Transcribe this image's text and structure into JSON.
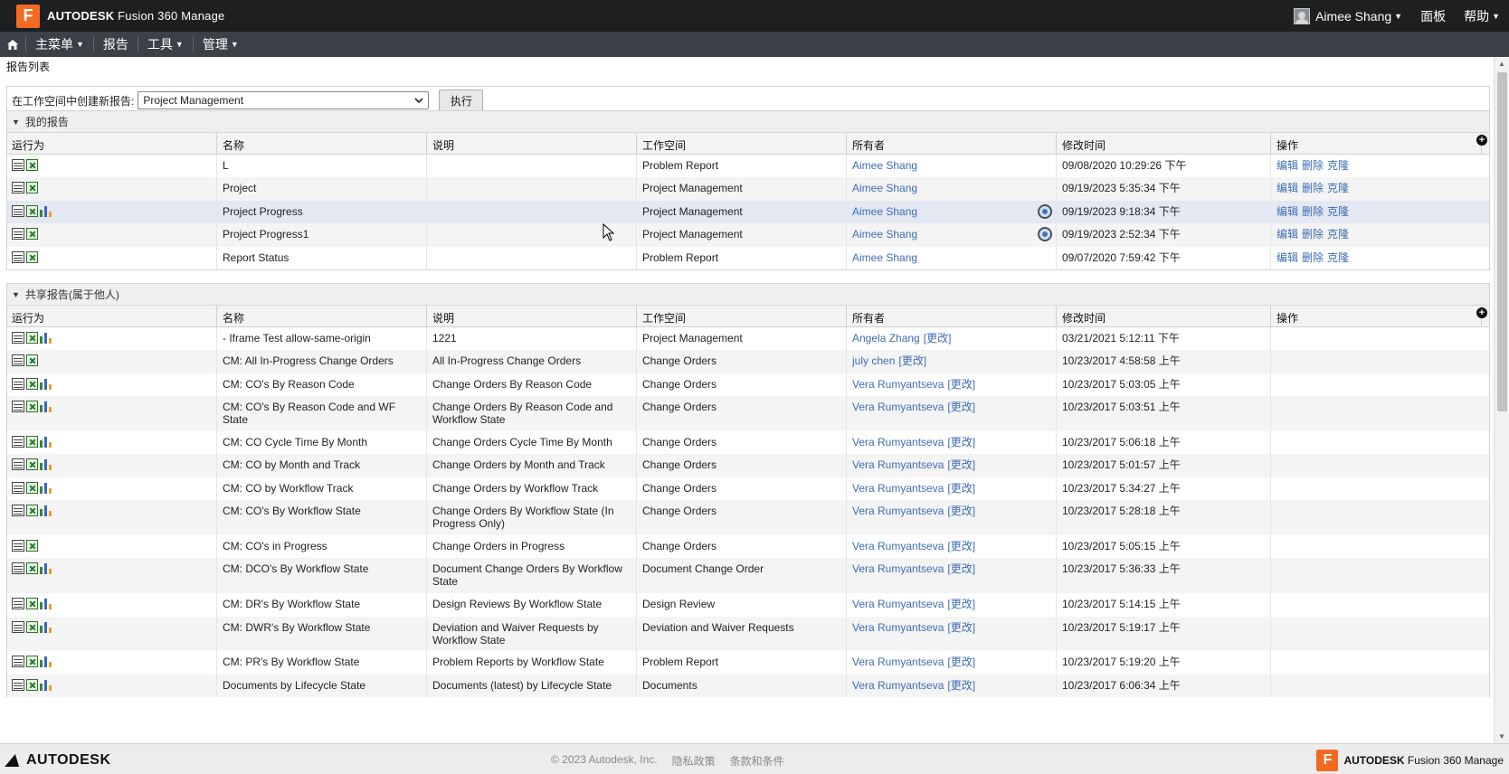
{
  "app": {
    "brand_bold": "AUTODESK",
    "brand_rest": "Fusion 360 Manage",
    "logo_letter": "F"
  },
  "topbar": {
    "user_name": "Aimee Shang",
    "dashboard": "面板",
    "help": "帮助"
  },
  "nav": {
    "main_menu": "主菜单",
    "reports": "报告",
    "tools": "工具",
    "admin": "管理"
  },
  "page": {
    "title": "报告列表"
  },
  "create": {
    "label": "在工作空间中创建新报告:",
    "selected_workspace": "Project Management",
    "execute": "执行"
  },
  "columns": [
    "运行为",
    "名称",
    "说明",
    "工作空间",
    "所有者",
    "修改时间",
    "操作"
  ],
  "my_reports": {
    "title": "我的报告",
    "actions": {
      "edit": "编辑",
      "delete": "删除",
      "clone": "克隆"
    },
    "rows": [
      {
        "icons": [
          "table",
          "xls"
        ],
        "name": "L",
        "desc": "",
        "workspace": "Problem Report",
        "owner": "Aimee Shang",
        "sync": false,
        "modified": "09/08/2020 10:29:26 下午"
      },
      {
        "icons": [
          "table",
          "xls"
        ],
        "name": "Project",
        "desc": "",
        "workspace": "Project Management",
        "owner": "Aimee Shang",
        "sync": false,
        "modified": "09/19/2023 5:35:34 下午"
      },
      {
        "icons": [
          "table",
          "xls",
          "chart"
        ],
        "name": "Project Progress",
        "desc": "",
        "workspace": "Project Management",
        "owner": "Aimee Shang",
        "sync": true,
        "modified": "09/19/2023 9:18:34 下午"
      },
      {
        "icons": [
          "table",
          "xls"
        ],
        "name": "Project Progress1",
        "desc": "",
        "workspace": "Project Management",
        "owner": "Aimee Shang",
        "sync": true,
        "modified": "09/19/2023 2:52:34 下午"
      },
      {
        "icons": [
          "table",
          "xls"
        ],
        "name": "Report Status",
        "desc": "",
        "workspace": "Problem Report",
        "owner": "Aimee Shang",
        "sync": false,
        "modified": "09/07/2020 7:59:42 下午"
      }
    ]
  },
  "shared_reports": {
    "title": "共享报告(属于他人)",
    "change_label": "[更改]",
    "rows": [
      {
        "icons": [
          "table",
          "xls",
          "chart"
        ],
        "name": "- Iframe Test allow-same-origin",
        "desc": "1221",
        "workspace": "Project Management",
        "owner": "Angela Zhang",
        "modified": "03/21/2021 5:12:11 下午"
      },
      {
        "icons": [
          "table",
          "xls"
        ],
        "name": "CM: All In-Progress Change Orders",
        "desc": "All In-Progress Change Orders",
        "workspace": "Change Orders",
        "owner": "july chen",
        "modified": "10/23/2017 4:58:58 上午"
      },
      {
        "icons": [
          "table",
          "xls",
          "chart"
        ],
        "name": "CM: CO's By Reason Code",
        "desc": "Change Orders By Reason Code",
        "workspace": "Change Orders",
        "owner": "Vera Rumyantseva",
        "modified": "10/23/2017 5:03:05 上午"
      },
      {
        "icons": [
          "table",
          "xls",
          "chart"
        ],
        "name": "CM: CO's By Reason Code and WF State",
        "desc": "Change Orders By Reason Code and Workflow State",
        "workspace": "Change Orders",
        "owner": "Vera Rumyantseva",
        "modified": "10/23/2017 5:03:51 上午"
      },
      {
        "icons": [
          "table",
          "xls",
          "chart"
        ],
        "name": "CM: CO Cycle Time By Month",
        "desc": "Change Orders Cycle Time By Month",
        "workspace": "Change Orders",
        "owner": "Vera Rumyantseva",
        "modified": "10/23/2017 5:06:18 上午"
      },
      {
        "icons": [
          "table",
          "xls",
          "chart"
        ],
        "name": "CM: CO by Month and Track",
        "desc": "Change Orders by Month and Track",
        "workspace": "Change Orders",
        "owner": "Vera Rumyantseva",
        "modified": "10/23/2017 5:01:57 上午"
      },
      {
        "icons": [
          "table",
          "xls",
          "chart"
        ],
        "name": "CM: CO by Workflow Track",
        "desc": "Change Orders by Workflow Track",
        "workspace": "Change Orders",
        "owner": "Vera Rumyantseva",
        "modified": "10/23/2017 5:34:27 上午"
      },
      {
        "icons": [
          "table",
          "xls",
          "chart"
        ],
        "name": "CM: CO's By Workflow State",
        "desc": "Change Orders By Workflow State (In Progress Only)",
        "workspace": "Change Orders",
        "owner": "Vera Rumyantseva",
        "modified": "10/23/2017 5:28:18 上午"
      },
      {
        "icons": [
          "table",
          "xls"
        ],
        "name": "CM: CO's in Progress",
        "desc": "Change Orders in Progress",
        "workspace": "Change Orders",
        "owner": "Vera Rumyantseva",
        "modified": "10/23/2017 5:05:15 上午"
      },
      {
        "icons": [
          "table",
          "xls",
          "chart"
        ],
        "name": "CM: DCO's By Workflow State",
        "desc": "Document Change Orders By Workflow State",
        "workspace": "Document Change Order",
        "owner": "Vera Rumyantseva",
        "modified": "10/23/2017 5:36:33 上午"
      },
      {
        "icons": [
          "table",
          "xls",
          "chart"
        ],
        "name": "CM: DR's By Workflow State",
        "desc": "Design Reviews By Workflow State",
        "workspace": "Design Review",
        "owner": "Vera Rumyantseva",
        "modified": "10/23/2017 5:14:15 上午"
      },
      {
        "icons": [
          "table",
          "xls",
          "chart"
        ],
        "name": "CM: DWR's By Workflow State",
        "desc": "Deviation and Waiver Requests by Workflow State",
        "workspace": "Deviation and Waiver Requests",
        "owner": "Vera Rumyantseva",
        "modified": "10/23/2017 5:19:17 上午"
      },
      {
        "icons": [
          "table",
          "xls",
          "chart"
        ],
        "name": "CM: PR's By Workflow State",
        "desc": "Problem Reports by Workflow State",
        "workspace": "Problem Report",
        "owner": "Vera Rumyantseva",
        "modified": "10/23/2017 5:19:20 上午"
      },
      {
        "icons": [
          "table",
          "xls",
          "chart"
        ],
        "name": "Documents by Lifecycle State",
        "desc": "Documents (latest) by Lifecycle State",
        "workspace": "Documents",
        "owner": "Vera Rumyantseva",
        "modified": "10/23/2017 6:06:34 上午"
      }
    ]
  },
  "footer": {
    "logo": "AUTODESK",
    "copyright": "© 2023 Autodesk, Inc.",
    "privacy": "隐私政策",
    "terms": "条款和条件",
    "brand_bold": "AUTODESK",
    "brand_rest": "Fusion 360 Manage",
    "logo_letter": "F"
  }
}
